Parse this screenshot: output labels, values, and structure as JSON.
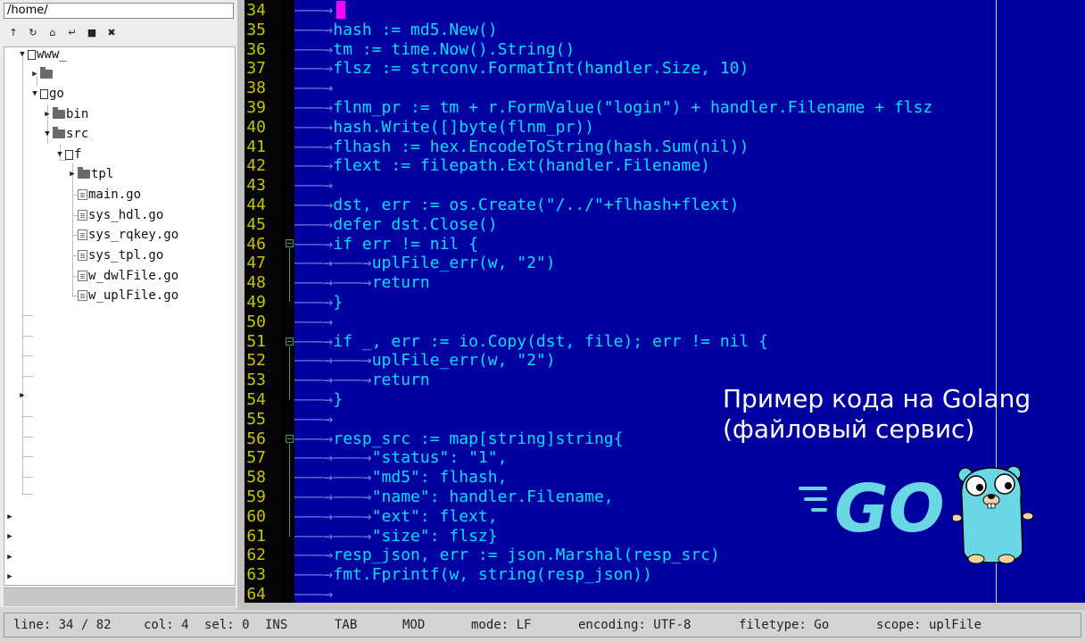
{
  "sidebar": {
    "path": "/home/",
    "toolbar": [
      {
        "name": "up-icon",
        "glyph": "↑"
      },
      {
        "name": "refresh-icon",
        "glyph": "↻"
      },
      {
        "name": "home-icon",
        "glyph": "⌂"
      },
      {
        "name": "enter-icon",
        "glyph": "↵"
      },
      {
        "name": "folder-icon",
        "glyph": "■"
      },
      {
        "name": "close-icon",
        "glyph": "✖"
      }
    ],
    "tree": {
      "www": "www_",
      "go": "go",
      "bin": "bin",
      "src": "src",
      "f": "f",
      "tpl": "tpl",
      "files": [
        "main.go",
        "sys_hdl.go",
        "sys_rqkey.go",
        "sys_tpl.go",
        "w_dwlFile.go",
        "w_uplFile.go"
      ]
    }
  },
  "editor": {
    "line_numbers": [
      "34",
      "35",
      "36",
      "37",
      "38",
      "39",
      "40",
      "41",
      "42",
      "43",
      "44",
      "45",
      "46",
      "47",
      "48",
      "49",
      "50",
      "51",
      "52",
      "53",
      "54",
      "55",
      "56",
      "57",
      "58",
      "59",
      "60",
      "61",
      "62",
      "63",
      "64"
    ],
    "lines": [
      "",
      "hash := md5.New()",
      "tm := time.Now().String()",
      "flsz := strconv.FormatInt(handler.Size, 10)",
      "",
      "flnm_pr := tm + r.FormValue(\"login\") + handler.Filename + flsz",
      "hash.Write([]byte(flnm_pr))",
      "flhash := hex.EncodeToString(hash.Sum(nil))",
      "flext := filepath.Ext(handler.Filename)",
      "",
      "dst, err := os.Create(\"/../\"+flhash+flext)",
      "defer dst.Close()",
      "if err != nil {",
      "uplFile_err(w, \"2\")",
      "return",
      "}",
      "",
      "if _, err := io.Copy(dst, file); err != nil {",
      "uplFile_err(w, \"2\")",
      "return",
      "}",
      "",
      "resp_src := map[string]string{",
      "\"status\": \"1\",",
      "\"md5\": flhash,",
      "\"name\": handler.Filename,",
      "\"ext\": flext,",
      "\"size\": flsz}",
      "resp_json, err := json.Marshal(resp_src)",
      "fmt.Fprintf(w, string(resp_json))",
      ""
    ],
    "indent": [
      1,
      1,
      1,
      1,
      1,
      1,
      1,
      1,
      1,
      1,
      1,
      1,
      1,
      2,
      2,
      1,
      1,
      1,
      2,
      2,
      1,
      1,
      1,
      2,
      2,
      2,
      2,
      2,
      1,
      1,
      1
    ]
  },
  "overlay": {
    "caption_line1": "Пример кода на Golang",
    "caption_line2": "(файловый сервис)",
    "logo_text": "GO"
  },
  "statusbar": {
    "line": "line: 34 / 82",
    "col": "col: 4",
    "sel": "sel: 0",
    "ins": "INS",
    "tab": "TAB",
    "mod": "MOD",
    "mode": "mode: LF",
    "encoding": "encoding: UTF-8",
    "filetype": "filetype: Go",
    "scope": "scope: uplFile"
  },
  "colors": {
    "editor_bg": "#0000a0",
    "code_text": "#00e0ff",
    "line_number": "#c8c400",
    "cursor": "#ff00ff",
    "gopher": "#6ad7e5"
  }
}
